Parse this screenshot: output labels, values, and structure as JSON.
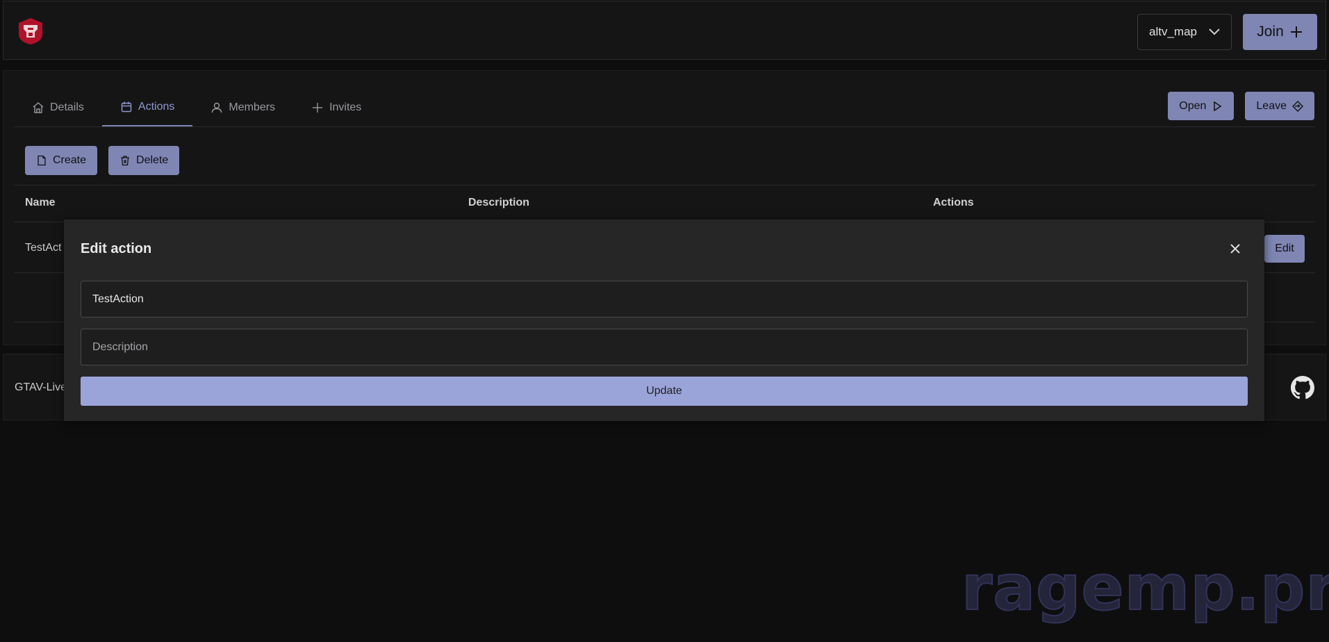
{
  "header": {
    "server_select": {
      "selected": "altv_map"
    },
    "join_label": "Join"
  },
  "tabs": [
    {
      "label": "Details",
      "icon": "home-icon"
    },
    {
      "label": "Actions",
      "icon": "calendar-icon",
      "active": true
    },
    {
      "label": "Members",
      "icon": "user-icon"
    },
    {
      "label": "Invites",
      "icon": "plus-icon"
    }
  ],
  "top_actions": {
    "open_label": "Open",
    "leave_label": "Leave"
  },
  "toolbar": {
    "create_label": "Create",
    "delete_label": "Delete"
  },
  "table": {
    "columns": [
      "Name",
      "Description",
      "Actions"
    ],
    "rows": [
      {
        "name": "TestAct",
        "edit_label": "Edit"
      }
    ]
  },
  "footer": {
    "text": "GTAV-Live"
  },
  "modal": {
    "title": "Edit action",
    "name_value": "TestAction",
    "description_placeholder": "Description",
    "update_label": "Update"
  },
  "watermark": "ragemp.pro",
  "colors": {
    "accent": "#7f86b4",
    "update": "#9ba4d9",
    "active_tab": "#9199cf"
  }
}
